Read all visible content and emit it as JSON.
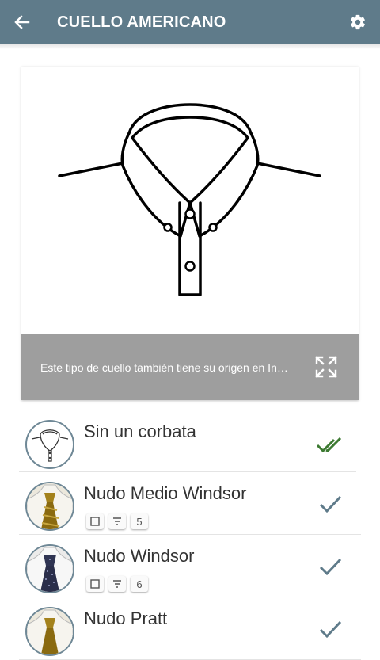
{
  "header": {
    "title": "CUELLO AMERICANO",
    "back_icon": "arrow-back-icon",
    "settings_icon": "gear-icon",
    "color": "#5f7b8a"
  },
  "collar_card": {
    "caption": "Este tipo de cuello también tiene su origen en Inglaterra",
    "expand_icon": "fullscreen-icon",
    "caption_bg": "#9e9e9e"
  },
  "knots": [
    {
      "name": "Sin un corbata",
      "status_icon": "double-check-icon",
      "status_color": "#3d7a32"
    },
    {
      "name": "Nudo Medio Windsor",
      "difficulty": "5",
      "status_icon": "check-icon",
      "status_color": "#5f7b8a"
    },
    {
      "name": "Nudo Windsor",
      "difficulty": "6",
      "status_icon": "check-icon",
      "status_color": "#5f7b8a"
    },
    {
      "name": "Nudo Pratt",
      "status_icon": "check-icon",
      "status_color": "#5f7b8a"
    }
  ]
}
